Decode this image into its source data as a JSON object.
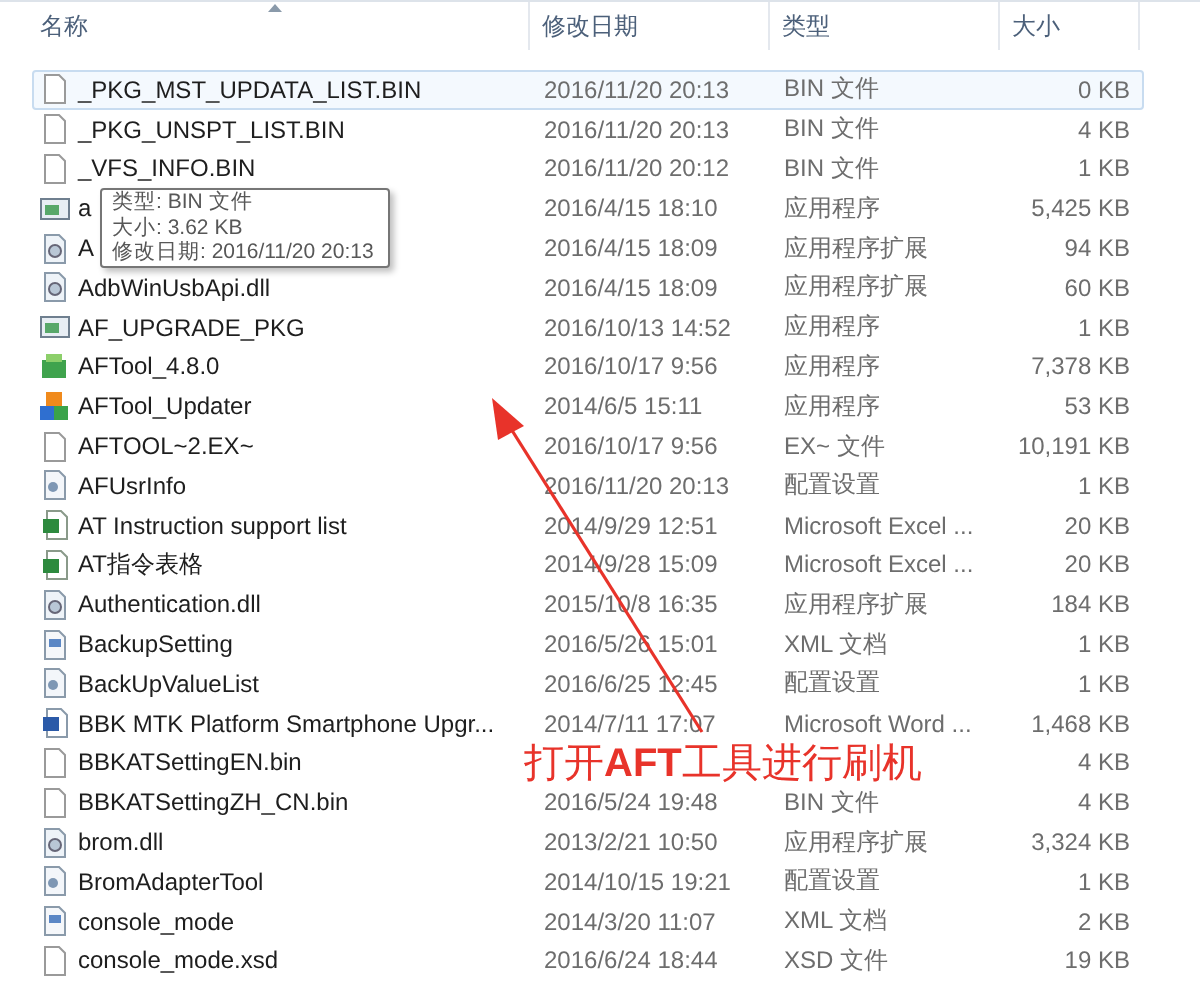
{
  "columns": [
    {
      "label": "名称",
      "sorted": true
    },
    {
      "label": "修改日期",
      "sorted": false
    },
    {
      "label": "类型",
      "sorted": false
    },
    {
      "label": "大小",
      "sorted": false
    }
  ],
  "rows": [
    {
      "kind": "file",
      "name": "_PKG_MST_UPDATA_LIST.BIN",
      "date": "2016/11/20 20:13",
      "type": "BIN 文件",
      "size": "0 KB",
      "highlighted": true
    },
    {
      "kind": "file",
      "name": "_PKG_UNSPT_LIST.BIN",
      "date": "2016/11/20 20:13",
      "type": "BIN 文件",
      "size": "4 KB",
      "highlighted": false
    },
    {
      "kind": "file",
      "name": "_VFS_INFO.BIN",
      "date": "2016/11/20 20:12",
      "type": "BIN 文件",
      "size": "1 KB",
      "highlighted": false
    },
    {
      "kind": "app",
      "name": "a",
      "date": "2016/4/15 18:10",
      "type": "应用程序",
      "size": "5,425 KB",
      "highlighted": false
    },
    {
      "kind": "dll",
      "name": "A",
      "date": "2016/4/15 18:09",
      "type": "应用程序扩展",
      "size": "94 KB",
      "highlighted": false
    },
    {
      "kind": "dll",
      "name": "AdbWinUsbApi.dll",
      "date": "2016/4/15 18:09",
      "type": "应用程序扩展",
      "size": "60 KB",
      "highlighted": false
    },
    {
      "kind": "app",
      "name": "AF_UPGRADE_PKG",
      "date": "2016/10/13 14:52",
      "type": "应用程序",
      "size": "1 KB",
      "highlighted": false
    },
    {
      "kind": "tool",
      "name": "AFTool_4.8.0",
      "date": "2016/10/17 9:56",
      "type": "应用程序",
      "size": "7,378 KB",
      "highlighted": false
    },
    {
      "kind": "updater",
      "name": "AFTool_Updater",
      "date": "2014/6/5 15:11",
      "type": "应用程序",
      "size": "53 KB",
      "highlighted": false
    },
    {
      "kind": "file",
      "name": "AFTOOL~2.EX~",
      "date": "2016/10/17 9:56",
      "type": "EX~ 文件",
      "size": "10,191 KB",
      "highlighted": false
    },
    {
      "kind": "config",
      "name": "AFUsrInfo",
      "date": "2016/11/20 20:13",
      "type": "配置设置",
      "size": "1 KB",
      "highlighted": false
    },
    {
      "kind": "excel",
      "name": "AT Instruction support list",
      "date": "2014/9/29 12:51",
      "type": "Microsoft Excel ...",
      "size": "20 KB",
      "highlighted": false
    },
    {
      "kind": "excel",
      "name": "AT指令表格",
      "date": "2014/9/28 15:09",
      "type": "Microsoft Excel ...",
      "size": "20 KB",
      "highlighted": false
    },
    {
      "kind": "dll",
      "name": "Authentication.dll",
      "date": "2015/10/8 16:35",
      "type": "应用程序扩展",
      "size": "184 KB",
      "highlighted": false
    },
    {
      "kind": "xml",
      "name": "BackupSetting",
      "date": "2016/5/26 15:01",
      "type": "XML 文档",
      "size": "1 KB",
      "highlighted": false
    },
    {
      "kind": "config",
      "name": "BackUpValueList",
      "date": "2016/6/25 12:45",
      "type": "配置设置",
      "size": "1 KB",
      "highlighted": false
    },
    {
      "kind": "word",
      "name": "BBK MTK Platform Smartphone Upgr...",
      "date": "2014/7/11 17:07",
      "type": "Microsoft Word ...",
      "size": "1,468 KB",
      "highlighted": false
    },
    {
      "kind": "file",
      "name": "BBKATSettingEN.bin",
      "size": "4 KB",
      "highlighted": false
    },
    {
      "kind": "file",
      "name": "BBKATSettingZH_CN.bin",
      "date": "2016/5/24 19:48",
      "type": "BIN 文件",
      "size": "4 KB",
      "highlighted": false
    },
    {
      "kind": "dll",
      "name": "brom.dll",
      "date": "2013/2/21 10:50",
      "type": "应用程序扩展",
      "size": "3,324 KB",
      "highlighted": false
    },
    {
      "kind": "config",
      "name": "BromAdapterTool",
      "date": "2014/10/15 19:21",
      "type": "配置设置",
      "size": "1 KB",
      "highlighted": false
    },
    {
      "kind": "xml",
      "name": "console_mode",
      "date": "2014/3/20 11:07",
      "type": "XML 文档",
      "size": "2 KB",
      "highlighted": false
    },
    {
      "kind": "file",
      "name": "console_mode.xsd",
      "date": "2016/6/24 18:44",
      "type": "XSD 文件",
      "size": "19 KB",
      "highlighted": false
    }
  ],
  "tooltip": {
    "lines": [
      "类型: BIN 文件",
      "大小: 3.62 KB",
      "修改日期: 2016/11/20 20:13"
    ]
  },
  "annotation": {
    "text": "打开**AFT**工具进行刷机"
  }
}
